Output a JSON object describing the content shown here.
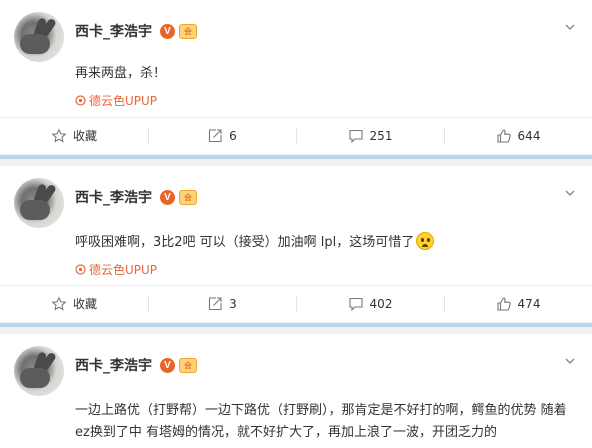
{
  "posts": [
    {
      "username": "西卡_李浩宇",
      "text": "再来两盘，杀！",
      "source": "德云色UPUP",
      "actions": {
        "favorite_label": "收藏",
        "repost_count": "6",
        "comment_count": "251",
        "like_count": "644"
      }
    },
    {
      "username": "西卡_李浩宇",
      "text": "呼吸困难啊，3比2吧  可以（接受）加油啊 lpl，这场可惜了",
      "source": "德云色UPUP",
      "actions": {
        "favorite_label": "收藏",
        "repost_count": "3",
        "comment_count": "402",
        "like_count": "474"
      }
    },
    {
      "username": "西卡_李浩宇",
      "text": "一边上路优（打野帮）一边下路优（打野刷），那肯定是不好打的啊，鳄鱼的优势 随着ez换到了中 有塔姆的情况，就不好扩大了，再加上浪了一波，开团乏力的"
    }
  ],
  "badges": {
    "vip": "V",
    "member": "会"
  },
  "icons": {
    "favorite": "star-icon",
    "repost": "repost-icon",
    "comment": "comment-icon",
    "like": "thumbs-up-icon",
    "more": "chevron-down-icon",
    "source": "source-icon",
    "emoji": "worried-face-emoji"
  },
  "colors": {
    "source": "#e8663a",
    "separator": "#bcd6ec",
    "vip_badge": "#e6662a"
  }
}
